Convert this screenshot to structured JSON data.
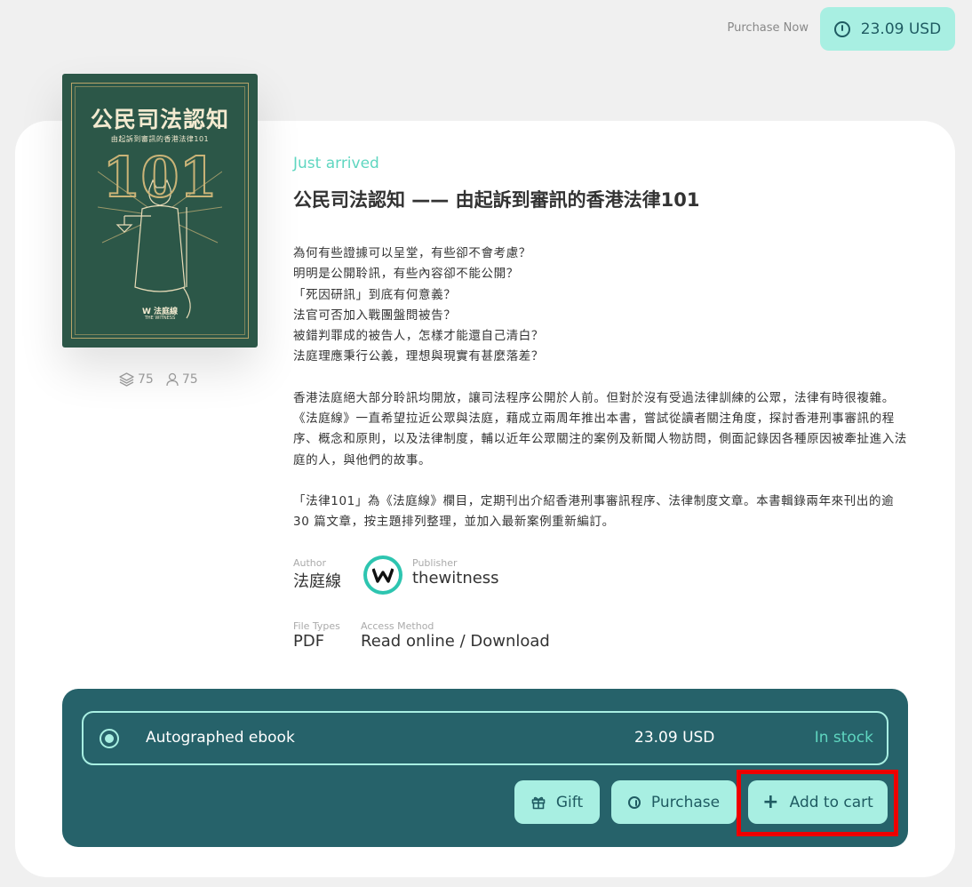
{
  "topbar": {
    "purchase_now_label": "Purchase Now",
    "price_button_label": "23.09 USD"
  },
  "cover": {
    "title": "公民司法認知",
    "subtitle": "由起訴到審訊的香港法律101",
    "number": "101",
    "logo_text": "W 法庭線",
    "logo_sub": "THE WITNESS"
  },
  "stats": {
    "pages_icon": "layers-icon",
    "pages_count": "75",
    "readers_icon": "user-icon",
    "readers_count": "75"
  },
  "book": {
    "badge": "Just arrived",
    "title": "公民司法認知 —— 由起訴到審訊的香港法律101",
    "description_lines": [
      "為何有些證據可以呈堂，有些卻不會考慮？",
      "明明是公開聆訊，有些內容卻不能公開？",
      "「死因研訊」到底有何意義？",
      "法官可否加入戰團盤問被告？",
      "被錯判罪成的被告人，怎樣才能還自己清白？",
      "法庭理應秉行公義，理想與現實有甚麼落差？"
    ],
    "description_p2": "香港法庭絕大部分聆訊均開放，讓司法程序公開於人前。但對於沒有受過法律訓練的公眾，法律有時很複雜。《法庭線》一直希望拉近公眾與法庭，藉成立兩周年推出本書，嘗試從讀者關注角度，探討香港刑事審訊的程序、概念和原則，以及法律制度，輔以近年公眾關注的案例及新聞人物訪問，側面記錄因各種原因被牽扯進入法庭的人，與他們的故事。",
    "description_p3": "「法律101」為《法庭線》欄目，定期刊出介紹香港刑事審訊程序、法律制度文章。本書輯錄兩年來刊出的逾 30 篇文章，按主題排列整理，並加入最新案例重新編訂。"
  },
  "meta": {
    "author_label": "Author",
    "author_value": "法庭線",
    "publisher_label": "Publisher",
    "publisher_value": "thewitness",
    "publisher_avatar_letter": "W",
    "file_types_label": "File Types",
    "file_types_value": "PDF",
    "access_label": "Access Method",
    "access_value": "Read online / Download"
  },
  "purchase": {
    "option_name": "Autographed ebook",
    "option_price": "23.09 USD",
    "option_stock": "In stock",
    "gift_label": "Gift",
    "purchase_label": "Purchase",
    "cart_label": "Add to cart",
    "cart_icon": "+"
  },
  "colors": {
    "accent_mint": "#a8efe2",
    "panel_teal": "#26626a",
    "text_teal": "#1f5b62",
    "badge_green": "#5fd6c0",
    "cover_green": "#2c5748",
    "highlight_red": "#ee0000"
  }
}
